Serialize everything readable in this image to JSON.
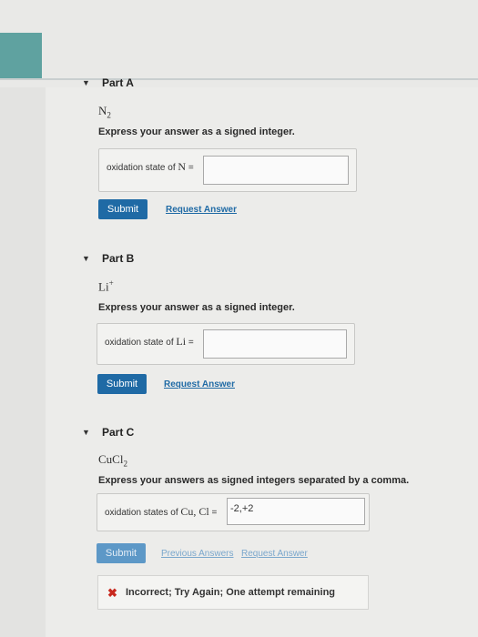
{
  "parts": [
    {
      "title": "Part A",
      "toggle_icon": "triangle-down-icon",
      "formula": "N",
      "formula_sub": "2",
      "instruction": "Express your answer as a signed integer.",
      "answer_label": "oxidation state of ",
      "answer_math": "N",
      "answer_eq": " =",
      "answer_value": "",
      "submit_label": "Submit",
      "links": [
        "Request Answer"
      ]
    },
    {
      "title": "Part B",
      "toggle_icon": "triangle-down-icon",
      "formula": "Li",
      "formula_sup": "+",
      "instruction": "Express your answer as a signed integer.",
      "answer_label": "oxidation state of ",
      "answer_math": "Li",
      "answer_eq": " =",
      "answer_value": "",
      "submit_label": "Submit",
      "links": [
        "Request Answer"
      ]
    },
    {
      "title": "Part C",
      "toggle_icon": "triangle-down-icon",
      "formula": "CuCl",
      "formula_sub": "2",
      "instruction": "Express your answers as signed integers separated by a comma.",
      "answer_label": "oxidation states of ",
      "answer_math": "Cu, Cl",
      "answer_eq": " =",
      "answer_value": "-2,+2",
      "submit_label": "Submit",
      "links": [
        "Previous Answers",
        "Request Answer"
      ]
    }
  ],
  "feedback": {
    "icon": "x-mark-icon",
    "message": "Incorrect; Try Again; One attempt remaining"
  },
  "colors": {
    "accent": "#1f6aa5",
    "sidebar_teal": "#5fa2a0",
    "error": "#c8281e"
  }
}
